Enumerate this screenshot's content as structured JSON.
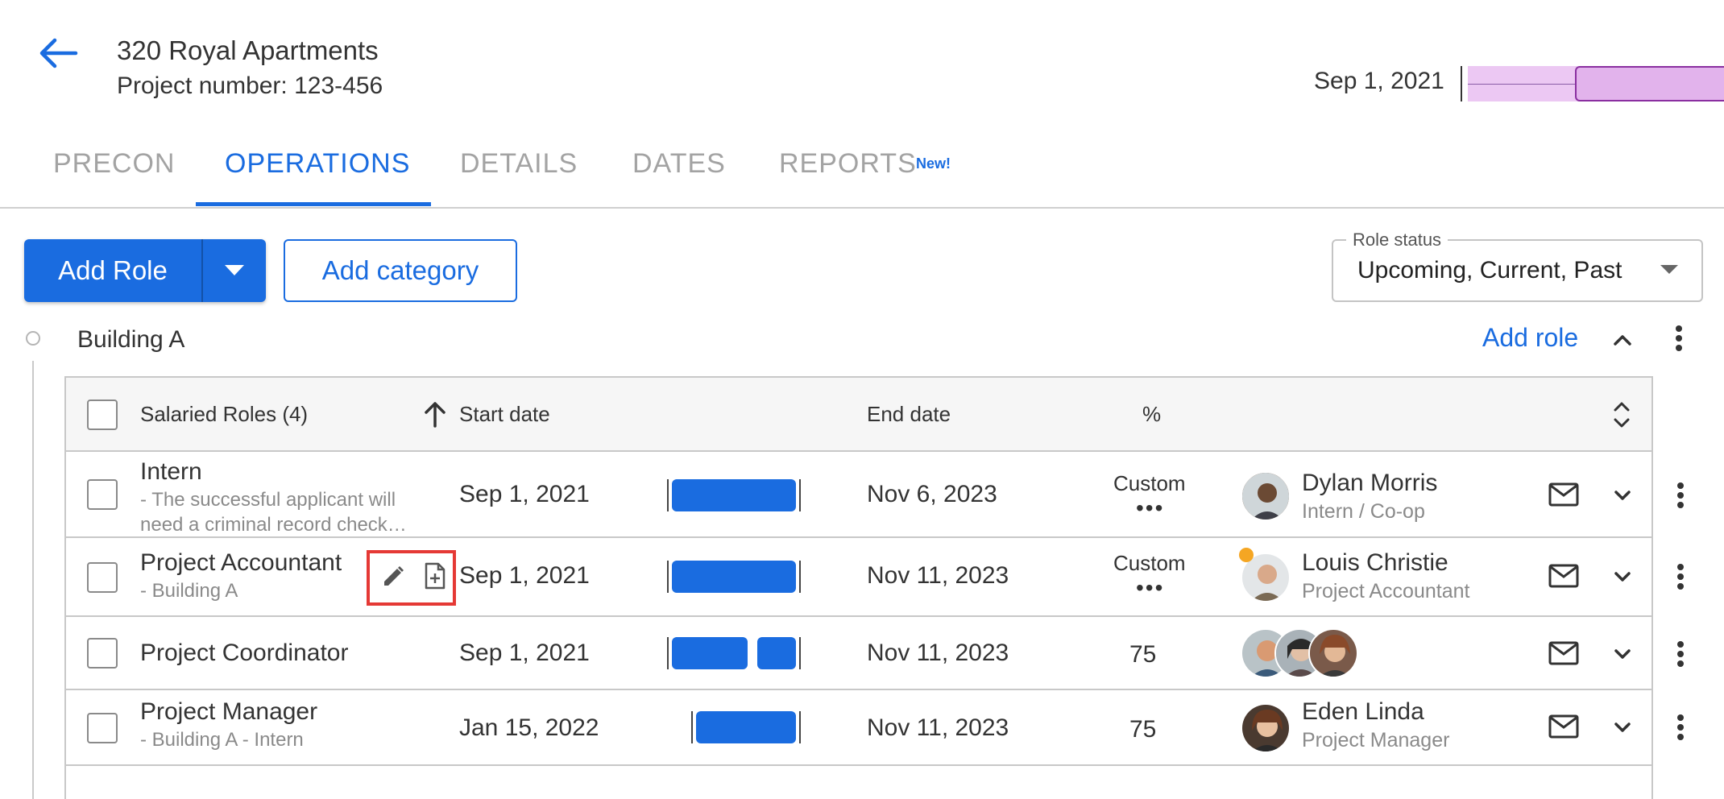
{
  "header": {
    "title": "320 Royal Apartments",
    "subtitle": "Project number: 123-456",
    "timeline_date": "Sep 1, 2021"
  },
  "tabs": [
    {
      "label": "PRECON",
      "active": false
    },
    {
      "label": "OPERATIONS",
      "active": true
    },
    {
      "label": "DETAILS",
      "active": false
    },
    {
      "label": "DATES",
      "active": false
    },
    {
      "label": "REPORTS",
      "active": false,
      "badge": "New!"
    }
  ],
  "toolbar": {
    "add_role": "Add Role",
    "add_category": "Add category",
    "role_status_label": "Role status",
    "role_status_value": "Upcoming, Current, Past"
  },
  "category": {
    "title": "Building A",
    "add_role": "Add role"
  },
  "table": {
    "columns": {
      "roles": "Salaried Roles (4)",
      "start": "Start date",
      "end": "End date",
      "percent": "%"
    },
    "rows": [
      {
        "name": "Intern",
        "sub": "- The successful applicant will need a criminal record check…",
        "start": "Sep 1, 2021",
        "end": "Nov 6, 2023",
        "percent": "Custom",
        "person_name": "Dylan Morris",
        "person_role": "Intern / Co-op"
      },
      {
        "name": "Project Accountant",
        "sub": "- Building A",
        "start": "Sep 1, 2021",
        "end": "Nov 11, 2023",
        "percent": "Custom",
        "person_name": "Louis Christie",
        "person_role": "Project Accountant"
      },
      {
        "name": "Project Coordinator",
        "sub": "",
        "start": "Sep 1, 2021",
        "end": "Nov 11, 2023",
        "percent": "75",
        "person_name": "",
        "person_role": ""
      },
      {
        "name": "Project Manager",
        "sub": "- Building A - Intern",
        "start": "Jan 15, 2022",
        "end": "Nov 11, 2023",
        "percent": "75",
        "person_name": "Eden Linda",
        "person_role": "Project Manager"
      }
    ]
  },
  "colors": {
    "accent": "#1a6ce0",
    "timeline_band": "#ecc8f3",
    "timeline_border": "#8a2fa0",
    "highlight": "#e53935",
    "status_dot": "#f5a623"
  }
}
